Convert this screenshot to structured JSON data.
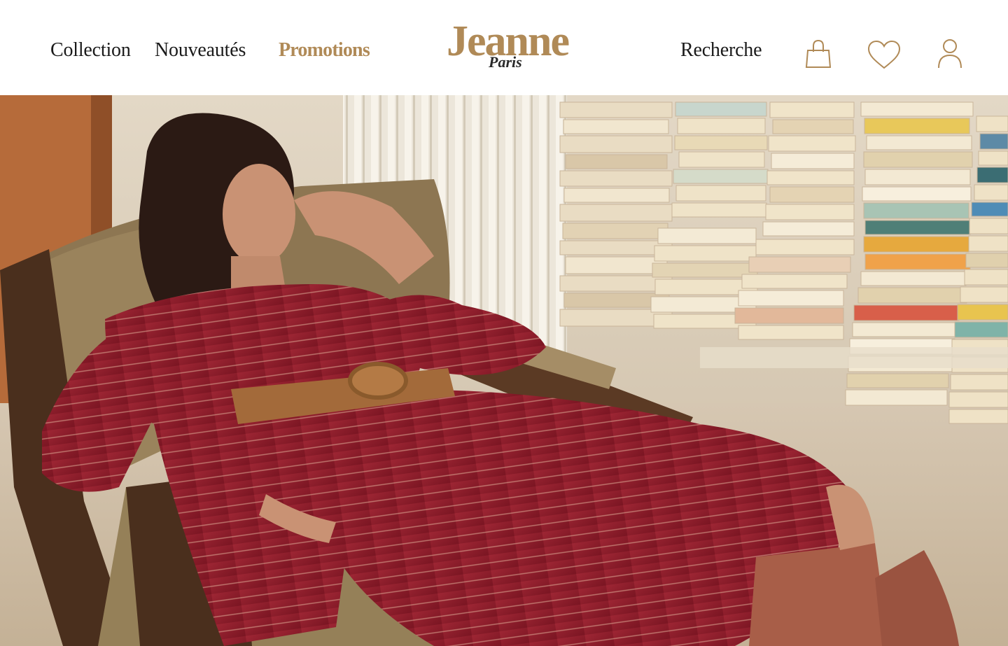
{
  "nav": {
    "collection": "Collection",
    "nouveautes": "Nouveautés",
    "promotions": "Promotions",
    "recherche": "Recherche"
  },
  "logo": {
    "name": "Jeanne",
    "city": "Paris"
  },
  "icons": {
    "bag": "shopping-bag-icon",
    "heart": "heart-icon",
    "user": "user-icon"
  },
  "colors": {
    "accent": "#b08a57",
    "text": "#1a1a1a",
    "dress": "#8e1d2a"
  }
}
